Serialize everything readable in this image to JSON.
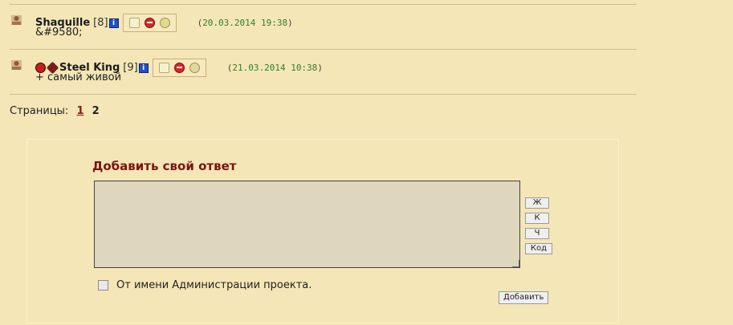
{
  "posts": [
    {
      "author": "Shaquille",
      "rank": "[8]",
      "info_icon": "i",
      "date": "20.03.2014 19:38",
      "date_open": "(",
      "date_close": ")",
      "text": "&#9580;",
      "badges": []
    },
    {
      "author": "Steel King",
      "rank": "[9]",
      "info_icon": "i",
      "date": "21.03.2014 10:38",
      "date_open": "(",
      "date_close": ")",
      "text": "+ самый живой",
      "badges": [
        "ladybug-icon",
        "bug-icon"
      ]
    }
  ],
  "pagination": {
    "label": "Страницы:",
    "pages": [
      "1",
      "2"
    ],
    "current": "1"
  },
  "reply": {
    "title": "Добавить свой ответ",
    "text_value": "",
    "format_buttons": [
      "Ж",
      "К",
      "Ч",
      "Код"
    ],
    "admin_checkbox_label": "От имени Администрации проекта.",
    "admin_checked": false,
    "submit_label": "Добавить"
  },
  "colors": {
    "background": "#f4e6b6",
    "title": "#7a1414",
    "date": "#2f7f2f",
    "current_page": "#7f1d1d"
  }
}
